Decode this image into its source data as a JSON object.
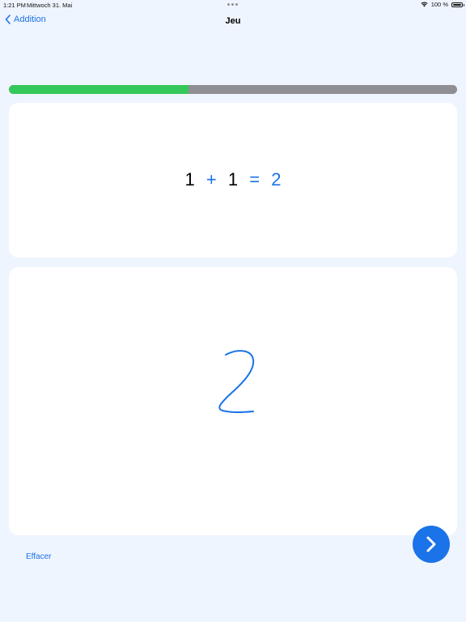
{
  "status_bar": {
    "time": "1:21 PM",
    "date": "Mittwoch 31. Mai",
    "battery_text": "100 %"
  },
  "nav": {
    "back_label": "Addition",
    "title": "Jeu"
  },
  "progress": {
    "fraction": 0.4
  },
  "equation": {
    "operand1": "1",
    "operator": "+",
    "operand2": "1",
    "equals": "=",
    "answer": "2"
  },
  "drawing": {
    "handwritten_digit": "2",
    "stroke_color": "#1a73e8"
  },
  "actions": {
    "clear_label": "Effacer",
    "next_icon": "chevron-right-icon"
  },
  "colors": {
    "background": "#eff5fe",
    "accent": "#1a73e8",
    "progress_done": "#34c759",
    "progress_remaining": "#8e8e93"
  }
}
